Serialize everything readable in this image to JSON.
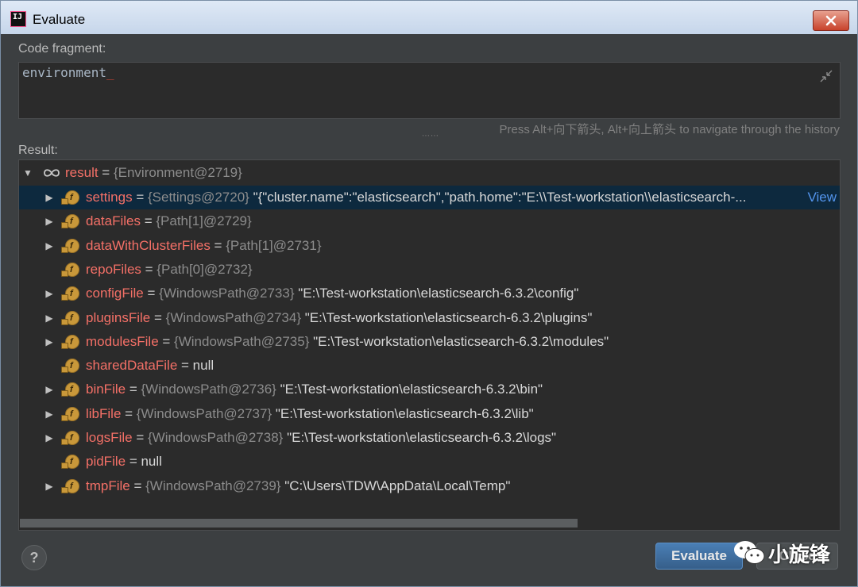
{
  "window": {
    "title": "Evaluate",
    "app_icon": "intellij-idea-icon"
  },
  "code_fragment": {
    "label": "Code fragment:",
    "value": "environment",
    "hint": "Press Alt+向下箭头, Alt+向上箭头 to navigate through the history"
  },
  "result": {
    "label": "Result:",
    "root": {
      "name": "result",
      "eq": " = ",
      "type": "{Environment@2719}"
    },
    "rows": [
      {
        "name": "settings",
        "type": "{Settings@2720}",
        "value": "\"{\"cluster.name\":\"elasticsearch\",\"path.home\":\"E:\\\\Test-workstation\\\\elasticsearch-...",
        "link": "View",
        "expandable": true,
        "selected": true
      },
      {
        "name": "dataFiles",
        "type": "{Path[1]@2729}",
        "value": "",
        "expandable": true
      },
      {
        "name": "dataWithClusterFiles",
        "type": "{Path[1]@2731}",
        "value": "",
        "expandable": true
      },
      {
        "name": "repoFiles",
        "type": "{Path[0]@2732}",
        "value": "",
        "expandable": false
      },
      {
        "name": "configFile",
        "type": "{WindowsPath@2733}",
        "value": "\"E:\\Test-workstation\\elasticsearch-6.3.2\\config\"",
        "expandable": true
      },
      {
        "name": "pluginsFile",
        "type": "{WindowsPath@2734}",
        "value": "\"E:\\Test-workstation\\elasticsearch-6.3.2\\plugins\"",
        "expandable": true
      },
      {
        "name": "modulesFile",
        "type": "{WindowsPath@2735}",
        "value": "\"E:\\Test-workstation\\elasticsearch-6.3.2\\modules\"",
        "expandable": true
      },
      {
        "name": "sharedDataFile",
        "type": "",
        "value": "null",
        "expandable": false
      },
      {
        "name": "binFile",
        "type": "{WindowsPath@2736}",
        "value": "\"E:\\Test-workstation\\elasticsearch-6.3.2\\bin\"",
        "expandable": true
      },
      {
        "name": "libFile",
        "type": "{WindowsPath@2737}",
        "value": "\"E:\\Test-workstation\\elasticsearch-6.3.2\\lib\"",
        "expandable": true
      },
      {
        "name": "logsFile",
        "type": "{WindowsPath@2738}",
        "value": "\"E:\\Test-workstation\\elasticsearch-6.3.2\\logs\"",
        "expandable": true
      },
      {
        "name": "pidFile",
        "type": "",
        "value": "null",
        "expandable": false
      },
      {
        "name": "tmpFile",
        "type": "{WindowsPath@2739}",
        "value": "\"C:\\Users\\TDW\\AppData\\Local\\Temp\"",
        "expandable": true
      }
    ]
  },
  "buttons": {
    "help": "?",
    "evaluate": "Evaluate",
    "close": "Close"
  },
  "watermark": {
    "text": "小旋锋",
    "icon": "wechat-icon"
  },
  "colors": {
    "background": "#3c3f41",
    "editor_bg": "#2b2b2b",
    "field_name": "#f47067",
    "type_text": "#8c8c8c",
    "link": "#5394ec",
    "selection": "#0d293e",
    "primary_button": "#4a7fb5"
  }
}
